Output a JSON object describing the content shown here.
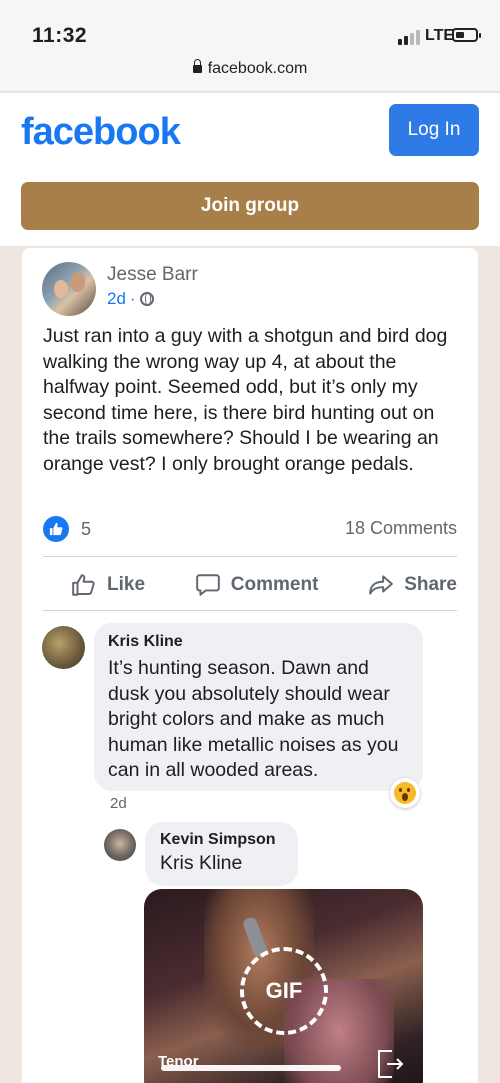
{
  "status_bar": {
    "time": "11:32",
    "network": "LTE"
  },
  "browser": {
    "url": "facebook.com"
  },
  "header": {
    "logo": "facebook",
    "login_label": "Log In",
    "join_label": "Join group",
    "brand_color": "#1877f2",
    "join_color": "#a87f48"
  },
  "post": {
    "author": "Jesse Barr",
    "time": "2d",
    "privacy_icon": "globe-icon",
    "text": "Just ran into a guy with a shotgun and bird dog walking the wrong way up 4, at about the halfway point. Seemed odd, but it’s only my second time here, is there bird hunting out on the trails somewhere? Should I be wearing an orange vest? I only brought orange pedals.",
    "reaction_count": "5",
    "comments_count": "18 Comments",
    "actions": {
      "like": "Like",
      "comment": "Comment",
      "share": "Share"
    }
  },
  "comments": [
    {
      "name": "Kris Kline",
      "text": "It’s hunting season. Dawn and dusk you absolutely should wear bright colors and make as much human like metallic noises as you can in all wooded areas.",
      "time": "2d",
      "reaction_icon": "wow-reaction-icon"
    },
    {
      "name": "Kevin Simpson",
      "text": "Kris Kline",
      "gif": {
        "badge": "GIF",
        "caption": "Tenor"
      }
    }
  ]
}
